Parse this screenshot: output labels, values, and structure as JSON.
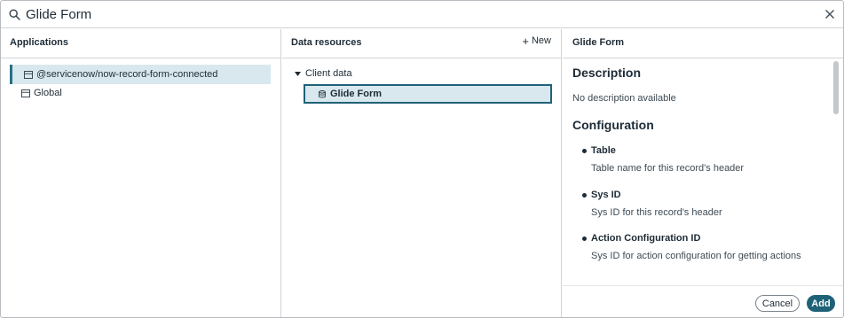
{
  "search": {
    "value": "Glide Form",
    "placeholder": ""
  },
  "applications": {
    "header": "Applications",
    "items": [
      {
        "label": "@servicenow/now-record-form-connected",
        "selected": true
      },
      {
        "label": "Global",
        "selected": false
      }
    ]
  },
  "resources": {
    "header": "Data resources",
    "new_label": "New",
    "tree": {
      "parent_label": "Client data",
      "child_label": "Glide Form"
    }
  },
  "detail": {
    "header": "Glide Form",
    "description_heading": "Description",
    "description_text": "No description available",
    "configuration_heading": "Configuration",
    "fields": [
      {
        "name": "Table",
        "desc": "Table name for this record's header"
      },
      {
        "name": "Sys ID",
        "desc": "Sys ID for this record's header"
      },
      {
        "name": "Action Configuration ID",
        "desc": "Sys ID for action configuration for getting actions"
      }
    ],
    "cancel_label": "Cancel",
    "add_label": "Add"
  },
  "colors": {
    "accent": "#1f6277",
    "selection_bg": "#d9e8ee",
    "border": "#cfd4d8"
  }
}
